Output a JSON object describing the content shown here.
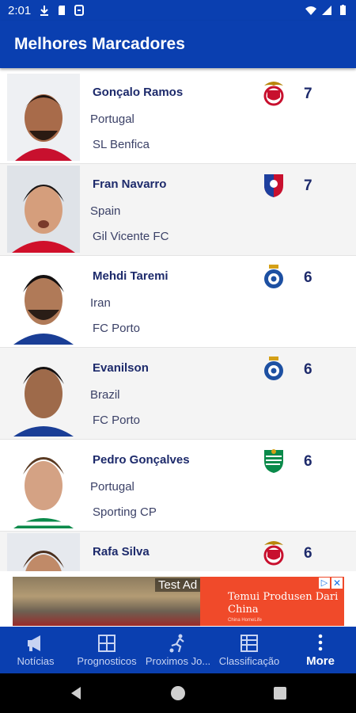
{
  "status_bar": {
    "time": "2:01"
  },
  "app_bar": {
    "title": "Melhores Marcadores"
  },
  "players": [
    {
      "name": "Gonçalo Ramos",
      "nationality": "Portugal",
      "club": "SL Benfica",
      "goals": "7",
      "crest": "benfica"
    },
    {
      "name": "Fran Navarro",
      "nationality": "Spain",
      "club": "Gil Vicente FC",
      "goals": "7",
      "crest": "gil-vicente"
    },
    {
      "name": "Mehdi Taremi",
      "nationality": "Iran",
      "club": "FC Porto",
      "goals": "6",
      "crest": "porto"
    },
    {
      "name": "Evanilson",
      "nationality": "Brazil",
      "club": "FC Porto",
      "goals": "6",
      "crest": "porto"
    },
    {
      "name": "Pedro Gonçalves",
      "nationality": "Portugal",
      "club": "Sporting CP",
      "goals": "6",
      "crest": "sporting"
    },
    {
      "name": "Rafa Silva",
      "nationality": "",
      "club": "",
      "goals": "6",
      "crest": "benfica"
    }
  ],
  "ad": {
    "label": "Test Ad",
    "headline": "Temui Produsen Dari China",
    "small": "China HomeLife"
  },
  "bottom_nav": [
    {
      "label": "Notícias",
      "icon": "megaphone-icon"
    },
    {
      "label": "Prognosticos",
      "icon": "grid-icon"
    },
    {
      "label": "Proximos Jo...",
      "icon": "player-kick-icon"
    },
    {
      "label": "Classificação",
      "icon": "table-icon"
    },
    {
      "label": "More",
      "icon": "more-vert-icon"
    }
  ],
  "colors": {
    "primary": "#0a3fb0",
    "text_dark": "#1d2a6b"
  }
}
